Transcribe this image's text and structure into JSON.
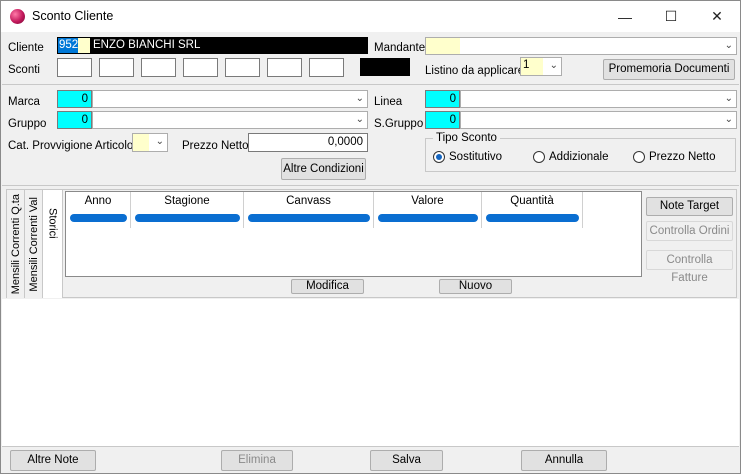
{
  "window": {
    "title": "Sconto Cliente",
    "controls": [
      "—",
      "☐",
      "✕"
    ]
  },
  "cliente": {
    "label": "Cliente",
    "code": "952",
    "name": "ENZO BIANCHI SRL"
  },
  "mandante": {
    "label": "Mandante",
    "value": ""
  },
  "sconti": {
    "label": "Sconti",
    "values": [
      "",
      "",
      "",
      "",
      "",
      "",
      ""
    ]
  },
  "listino": {
    "label": "Listino da applicare",
    "value": "1"
  },
  "promemoria_button": "Promemoria  Documenti",
  "marca": {
    "label": "Marca",
    "code": "0",
    "value": ""
  },
  "linea": {
    "label": "Linea",
    "code": "0",
    "value": ""
  },
  "gruppo": {
    "label": "Gruppo",
    "code": "0",
    "value": ""
  },
  "sgruppo": {
    "label": "S.Gruppo",
    "code": "0",
    "value": ""
  },
  "cat_provvigione": {
    "label": "Cat. Provvigione Articolo",
    "value": ""
  },
  "prezzo_netto": {
    "label": "Prezzo Netto",
    "value": "0,0000"
  },
  "altre_condizioni_button": "Altre Condizioni",
  "tipo_sconto": {
    "legend": "Tipo Sconto",
    "options": [
      {
        "label": "Sostitutivo",
        "selected": true
      },
      {
        "label": "Addizionale",
        "selected": false
      },
      {
        "label": "Prezzo Netto",
        "selected": false
      }
    ]
  },
  "vertical_tabs": [
    "Mensili Correnti  Q.ta",
    "Mensili Correnti  Val",
    "Storici"
  ],
  "table": {
    "columns": [
      "Anno",
      "Stagione",
      "Canvass",
      "Valore",
      "Quantità"
    ]
  },
  "modifica_button": "Modifica",
  "nuovo_button": "Nuovo",
  "side_buttons": [
    {
      "label": "Note Target",
      "enabled": true
    },
    {
      "label": "Controlla Ordini",
      "enabled": false
    },
    {
      "label": "Controlla Fatture",
      "enabled": false
    }
  ],
  "bottom_buttons": [
    {
      "label": "Altre Note",
      "enabled": true
    },
    {
      "label": "Elimina",
      "enabled": false
    },
    {
      "label": "Salva",
      "enabled": true
    },
    {
      "label": "Annulla",
      "enabled": true
    }
  ],
  "colors": {
    "cyan_field": "#00ffff",
    "yellow_field": "#ffffcc",
    "bar_blue": "#0a6ed1",
    "dark_field": "#000000"
  }
}
